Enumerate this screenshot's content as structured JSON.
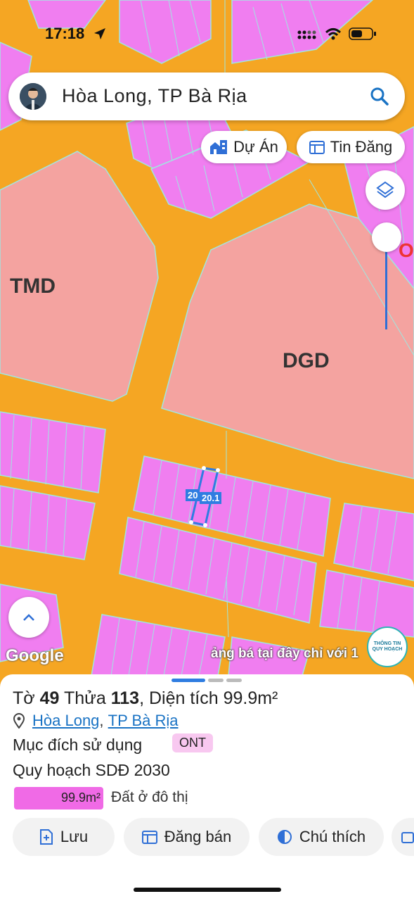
{
  "status": {
    "time": "17:18"
  },
  "search": {
    "query": "Hòa Long, TP Bà Rịa"
  },
  "chips": {
    "du_an": "Dự Án",
    "tin_dang": "Tin Đăng"
  },
  "map": {
    "zone_tmd": "TMD",
    "zone_dgd": "DGD",
    "plot_label_a": "20",
    "plot_label_b": "20.1",
    "google": "Google",
    "marquee": "ảng bá tại đây chỉ với 1",
    "badge_line1": "THÔNG TIN",
    "badge_line2": "QUY HOẠCH"
  },
  "sheet": {
    "to_label": "Tờ",
    "to_value": "49",
    "thua_label": "Thửa",
    "thua_value": "113",
    "dien_tich_label": ", Diện tích",
    "dien_tich_value": "99.9m²",
    "ward": "Hòa Long",
    "city": "TP Bà Rịa",
    "purpose_label": "Mục đích sử dụng",
    "purpose_code": "ONT",
    "plan_label": "Quy hoạch SDĐ 2030",
    "area_value": "99.9m²",
    "area_desc": "Đất ở đô thị"
  },
  "actions": {
    "luu": "Lưu",
    "dang_ban": "Đăng bán",
    "chu_thich": "Chú thích"
  },
  "colors": {
    "road": "#f5a623",
    "residential": "#f07ef0",
    "commercial": "#f4a3a0",
    "accent": "#1a73c4"
  }
}
